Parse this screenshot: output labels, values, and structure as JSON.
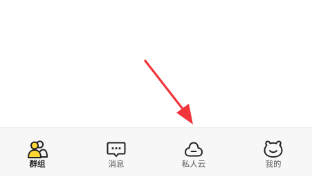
{
  "colors": {
    "accent": "#ffd633",
    "icon_stroke": "#222222",
    "arrow": "#f0353b",
    "tabbar_bg": "#f7f7f7"
  },
  "tabbar": {
    "tabs": [
      {
        "label": "群组",
        "icon": "group-icon",
        "active": true
      },
      {
        "label": "消息",
        "icon": "message-icon",
        "active": false
      },
      {
        "label": "私人云",
        "icon": "cloud-icon",
        "active": false
      },
      {
        "label": "我的",
        "icon": "bear-face-icon",
        "active": false
      }
    ]
  }
}
